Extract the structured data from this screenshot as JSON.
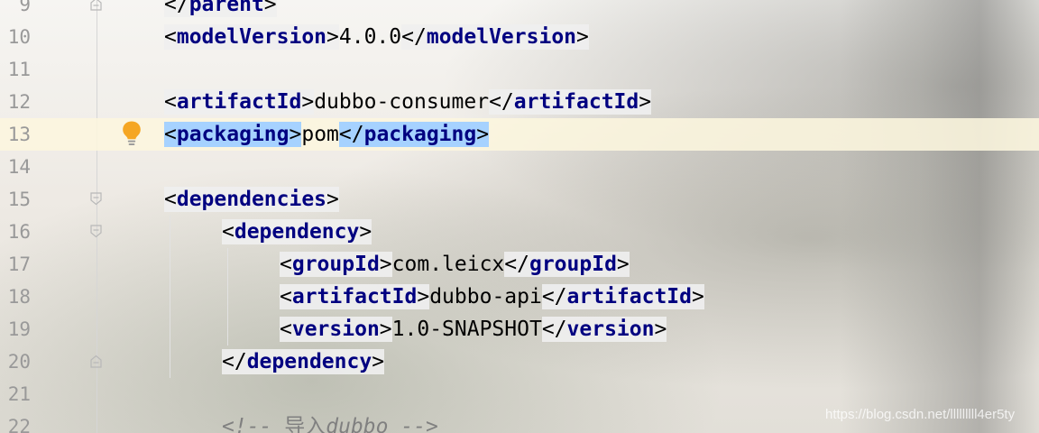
{
  "editor": {
    "lines": [
      {
        "number": "9",
        "open": "</",
        "tag": "parent",
        "close": ">"
      },
      {
        "number": "10",
        "open_a": "<",
        "tag_a": "modelVersion",
        "close_a": ">",
        "content": "4.0.0",
        "open_b": "</",
        "tag_b": "modelVersion",
        "close_b": ">"
      },
      {
        "number": "11"
      },
      {
        "number": "12",
        "open_a": "<",
        "tag_a": "artifactId",
        "close_a": ">",
        "content": "dubbo-consumer",
        "open_b": "</",
        "tag_b": "artifactId",
        "close_b": ">"
      },
      {
        "number": "13",
        "open_a": "<",
        "tag_a": "packaging",
        "close_a": ">",
        "content": "pom",
        "open_b": "</",
        "tag_b": "packaging",
        "close_b": ">"
      },
      {
        "number": "14"
      },
      {
        "number": "15",
        "open": "<",
        "tag": "dependencies",
        "close": ">"
      },
      {
        "number": "16",
        "open": "<",
        "tag": "dependency",
        "close": ">"
      },
      {
        "number": "17",
        "open_a": "<",
        "tag_a": "groupId",
        "close_a": ">",
        "content": "com.leicx",
        "open_b": "</",
        "tag_b": "groupId",
        "close_b": ">"
      },
      {
        "number": "18",
        "open_a": "<",
        "tag_a": "artifactId",
        "close_a": ">",
        "content": "dubbo-api",
        "open_b": "</",
        "tag_b": "artifactId",
        "close_b": ">"
      },
      {
        "number": "19",
        "open_a": "<",
        "tag_a": "version",
        "close_a": ">",
        "content": "1.0-SNAPSHOT",
        "open_b": "</",
        "tag_b": "version",
        "close_b": ">"
      },
      {
        "number": "20",
        "open": "</",
        "tag": "dependency",
        "close": ">"
      },
      {
        "number": "21"
      },
      {
        "number": "22",
        "comment_start": "<!-- ",
        "comment_cjk": "导入",
        "comment_word": "dubbo",
        "comment_end": " -->"
      }
    ],
    "icons": {
      "bulb": "lightbulb-icon",
      "fold": "fold-marker-icon"
    },
    "colors": {
      "tag": "#000080",
      "text": "#000000",
      "line_number": "#999999",
      "comment": "#808080",
      "current_line": "#fcf6de",
      "match_highlight": "#a6d2ff",
      "bulb": "#f5a623"
    }
  },
  "watermark": "https://blog.csdn.net/lllllllll4er5ty"
}
